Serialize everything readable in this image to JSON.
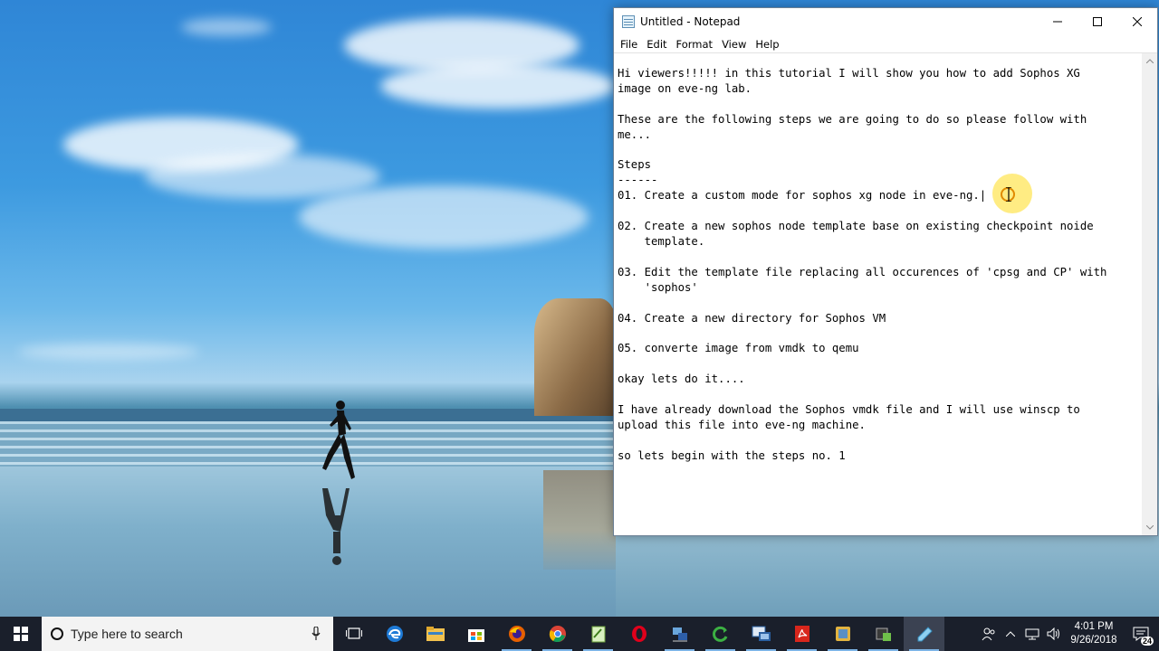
{
  "window": {
    "title": "Untitled - Notepad"
  },
  "menu": {
    "items": [
      "File",
      "Edit",
      "Format",
      "View",
      "Help"
    ]
  },
  "document": {
    "lines": [
      "Hi viewers!!!!! in this tutorial I will show you how to add Sophos XG",
      "image on eve-ng lab.",
      "",
      "These are the following steps we are going to do so please follow with",
      "me...",
      "",
      "Steps",
      "------",
      "01. Create a custom mode for sophos xg node in eve-ng.|",
      "",
      "02. Create a new sophos node template base on existing checkpoint noide",
      "    template.",
      "",
      "03. Edit the template file replacing all occurences of 'cpsg and CP' with",
      "    'sophos'",
      "",
      "04. Create a new directory for Sophos VM",
      "",
      "05. converte image from vmdk to qemu",
      "",
      "okay lets do it....",
      "",
      "I have already download the Sophos vmdk file and I will use winscp to",
      "upload this file into eve-ng machine.",
      "",
      "so lets begin with the steps no. 1"
    ]
  },
  "taskbar": {
    "search_placeholder": "Type here to search",
    "pinned_icons": [
      "task-view-icon",
      "edge-icon",
      "file-explorer-icon",
      "store-icon",
      "firefox-icon",
      "chrome-icon",
      "notepadpp-icon",
      "opera-icon",
      "network-tool-icon",
      "refresh-tool-icon",
      "vmware-icon",
      "acrobat-icon",
      "app-icon",
      "windows-app-icon",
      "notepad-icon"
    ],
    "clock_time": "4:01 PM",
    "clock_date": "9/26/2018",
    "notification_count": "24"
  },
  "colors": {
    "taskbar_bg": "#1a1f2b",
    "accent": "#7db4e6"
  }
}
